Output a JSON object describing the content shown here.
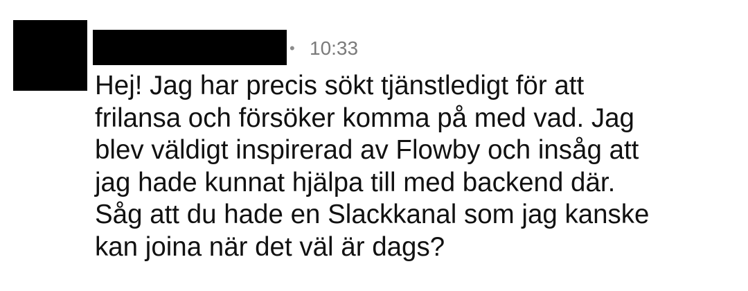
{
  "message": {
    "meta_separator": "•",
    "timestamp": "10:33",
    "lines": [
      "Hej! Jag har precis sökt tjänstledigt för att",
      "frilansa och försöker komma på med vad. Jag",
      "blev väldigt inspirerad av Flowby och insåg att",
      "jag hade kunnat hjälpa till med backend där.",
      "Såg att du hade en Slackkanal som jag kanske",
      "kan joina när det väl är dags?"
    ]
  }
}
